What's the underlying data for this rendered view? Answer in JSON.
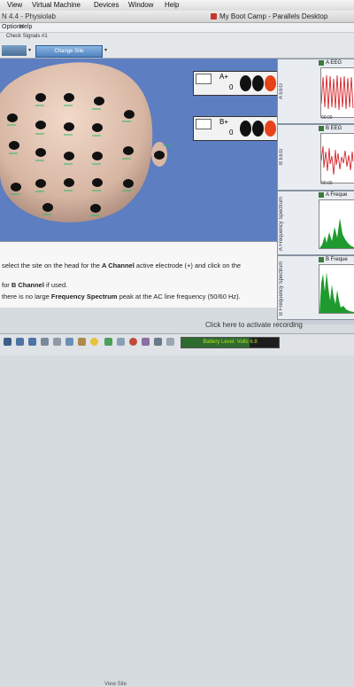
{
  "mac_menu": {
    "items": [
      "View",
      "Virtual Machine",
      "Devices",
      "Window",
      "Help"
    ]
  },
  "window": {
    "app_title_fragment": "N 4.4 - Physiolab",
    "parallels_title": "My Boot Camp - Parallels Desktop"
  },
  "app_menu": {
    "items": [
      "Options",
      "Help"
    ]
  },
  "toolbar": {
    "check_signals_label": "Check Signals #1",
    "change_site_label": "Change Site"
  },
  "channels": [
    {
      "name": "A+",
      "value": "0",
      "dot_colors": [
        "#111111",
        "#111111",
        "#e8421a"
      ]
    },
    {
      "name": "B+",
      "value": "0",
      "dot_colors": [
        "#111111",
        "#111111",
        "#e8421a"
      ]
    }
  ],
  "graphs": [
    {
      "axis_label": "A EEG",
      "title": "A EEG",
      "tick_label": "00:00"
    },
    {
      "axis_label": "B EEG",
      "title": "B EEG",
      "tick_label": "00:00"
    },
    {
      "axis_label": "A Frequency Spectrum",
      "title": "A Freque"
    },
    {
      "axis_label": "B Frequency Spectrum",
      "title": "B Freque"
    }
  ],
  "instructions": {
    "line1_a": "select the site on the head for the ",
    "line1_b": "A Channel",
    "line1_c": " active electrode (+) and click on the",
    "line2_a": "for ",
    "line2_b": "B Channel",
    "line2_c": " if used.",
    "line3_a": "there is no large ",
    "line3_b": "Frequency Spectrum",
    "line3_c": " peak at the AC line frequency (50/60 Hz)."
  },
  "activate_text": "Click here to activate recording",
  "battery_text": "Battery Level: Volts  6.8",
  "battery_level": 0.7,
  "bottom_label": "View Site",
  "accent": {
    "head_background": "#5d7ec0",
    "electrode_label": "#2bb86a",
    "spectrum_green": "#1e9a2e",
    "eeg_red": "#d8232a"
  }
}
